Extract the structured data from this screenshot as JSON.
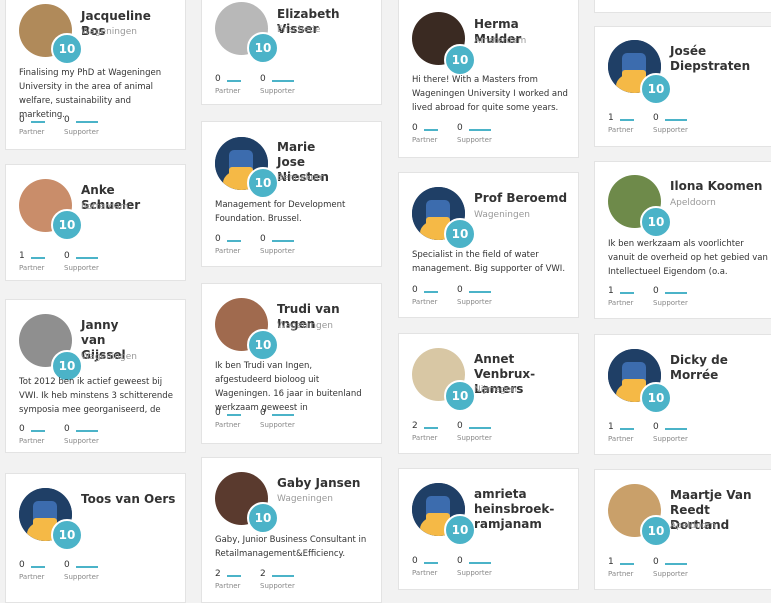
{
  "colors": {
    "accent": "#4bb3c8",
    "card_bg": "#ffffff",
    "page_bg": "#f2f2f2"
  },
  "labels": {
    "partner": "Partner",
    "supporter": "Supporter"
  },
  "cards": [
    {
      "name": "Jacqueline Bos",
      "city": "Wageningen",
      "level": "10",
      "avatar": "photo",
      "bio": "Finalising my PhD at Wageningen University in the area of animal welfare, sustainability and marketing.",
      "partner": "0",
      "supporter": "0"
    },
    {
      "name": "Anke Schueler",
      "city": "Rotterdam",
      "level": "10",
      "avatar": "photo",
      "bio": "",
      "partner": "1",
      "supporter": "0"
    },
    {
      "name": "Janny van Gijssel",
      "city": "Wageningen",
      "level": "10",
      "avatar": "photo",
      "bio": "Tot 2012 ben ik actief geweest bij VWI. Ik heb minstens 3 schitterende symposia mee georganiseerd, de",
      "partner": "0",
      "supporter": "0"
    },
    {
      "name": "Toos van Oers",
      "city": "",
      "level": "10",
      "avatar": "default-avatar-icon",
      "bio": "",
      "partner": "0",
      "supporter": "0"
    },
    {
      "name": "Elizabeth Visser",
      "city": "Enschede",
      "level": "10",
      "avatar": "photo",
      "bio": "",
      "partner": "0",
      "supporter": "0"
    },
    {
      "name": "Marie Jose Niesten",
      "city": "Bennekom",
      "level": "10",
      "avatar": "default-avatar-icon",
      "bio": "Management for Development Foundation. Brussel.",
      "partner": "0",
      "supporter": "0"
    },
    {
      "name": "Trudi van Ingen",
      "city": "Wageningen",
      "level": "10",
      "avatar": "photo",
      "bio": "Ik ben Trudi van Ingen, afgestudeerd bioloog uit Wageningen. 16 jaar in buitenland werkzaam geweest in",
      "partner": "0",
      "supporter": "0"
    },
    {
      "name": "Gaby Jansen",
      "city": "Wageningen",
      "level": "10",
      "avatar": "photo",
      "bio": "Gaby, Junior Business Consultant in Retailmanagement&Efficiency.",
      "partner": "2",
      "supporter": "2"
    },
    {
      "name": "Herma Mulder",
      "city": "Amsterdam",
      "level": "10",
      "avatar": "photo",
      "bio": "Hi there! With a Masters from Wageningen University I worked and lived abroad for quite some years.",
      "partner": "0",
      "supporter": "0"
    },
    {
      "name": "Prof Beroemd",
      "city": "Wageningen",
      "level": "10",
      "avatar": "default-avatar-icon",
      "bio": "Specialist in the field of water management. Big supporter of VWI.",
      "partner": "0",
      "supporter": "0"
    },
    {
      "name": "Annet Venbrux-Lamers",
      "city": "Nijmegen",
      "level": "10",
      "avatar": "photo",
      "bio": "",
      "partner": "2",
      "supporter": "0"
    },
    {
      "name": "amrieta heinsbroek-ramjanam",
      "city": "",
      "level": "10",
      "avatar": "default-avatar-icon",
      "bio": "",
      "partner": "0",
      "supporter": "0"
    },
    {
      "name": "Josée Diepstraten",
      "city": "",
      "level": "10",
      "avatar": "default-avatar-icon",
      "bio": "",
      "partner": "1",
      "supporter": "0"
    },
    {
      "name": "Ilona Koomen",
      "city": "Apeldoorn",
      "level": "10",
      "avatar": "photo",
      "bio": "Ik ben werkzaam als voorlichter vanuit de overheid op het gebied van Intellectueel Eigendom (o.a.",
      "partner": "1",
      "supporter": "0"
    },
    {
      "name": "Dicky de Morrée",
      "city": "",
      "level": "10",
      "avatar": "default-avatar-icon",
      "bio": "",
      "partner": "1",
      "supporter": "0"
    },
    {
      "name": "Maartje Van Reedt Dortland",
      "city": "Apeldoorn",
      "level": "10",
      "avatar": "photo",
      "bio": "",
      "partner": "1",
      "supporter": "0"
    }
  ]
}
